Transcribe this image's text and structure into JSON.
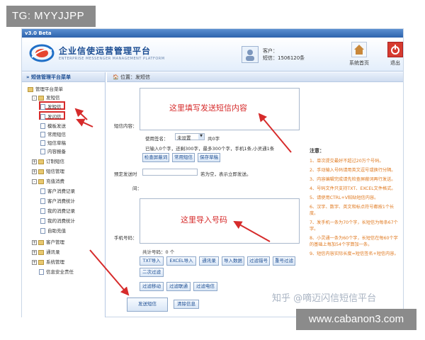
{
  "watermarks": {
    "tg": "TG: MYYJJPP",
    "site": "www.cabanon3.com",
    "zhihu": "知乎 @嘀迈闪信短信平台"
  },
  "window": {
    "version": "v3.0 Beta"
  },
  "header": {
    "brand": "企业信使运营管理平台",
    "brand_sub": "ENTERPRISE MESSENGER MANAGEMENT PLATFORM",
    "customer_label": "客户：",
    "sms_label": "短信：1506120条",
    "home_label": "系统首页",
    "exit_label": "退出"
  },
  "sidebar": {
    "title": "» 短信管理平台菜单",
    "root": "管理平台菜单",
    "send_group": "发短信",
    "items": [
      "发短信",
      "发闪信",
      "模板发送",
      "常用短信",
      "短信草稿",
      "内容报备"
    ],
    "groups": [
      "订制短信",
      "短信管理",
      "充值消费"
    ],
    "recharge_items": [
      "客户消费记录",
      "客户消费统计",
      "我的消费记录",
      "我的消费统计",
      "自助充值"
    ],
    "bottom_groups": [
      "客户管理",
      "通讯录",
      "系统管理",
      "信息安全责任"
    ]
  },
  "main": {
    "breadcrumb": "位置：发短信",
    "content_label": "短信内容：",
    "content_hint": "这里填写发送短信内容",
    "sign_label": "使用签名：",
    "sign_value": "未设置",
    "char_count": "共0字",
    "counter_text": "已输入0个字，还剩300字，最多300个字，手机1条,小灵通1条",
    "btn_check": "检查屏蔽词",
    "btn_common": "常用短信",
    "btn_draft": "保存草稿",
    "schedule_label": "预定发送时",
    "schedule_label2": "间：",
    "schedule_hint": "若为空，表示立即发送。",
    "phone_label": "手机号码：",
    "phone_hint": "这里导入号码",
    "total_label": "共计号码：0 个",
    "import_buttons": [
      "TXT导入",
      "EXCEL导入",
      "通讯录",
      "导入数据",
      "过滤错号",
      "重号过滤"
    ],
    "btn_filter2": "二次过滤",
    "filter_buttons": [
      "过滤移动",
      "过滤联通",
      "过滤电信"
    ],
    "btn_send": "发送短信",
    "btn_clear": "清除信息"
  },
  "notes": {
    "title": "注意：",
    "items": [
      "1、单次提交最好不超过20万个号码。",
      "2、手动输入号码请用英文逗号或换行分隔。",
      "3、内容编辑完成请先检查屏蔽词再行发送。",
      "4、号码文件只支持TXT、EXCEL文件格式。",
      "5、请使用CTRL+V粘贴短信内容。",
      "6、汉字、数字、英文和标点符号都按1个长度。",
      "7、发手机一条为70个字，长短信为每条67个字。",
      "8、小灵通一条为60个字，长短信在每60个字的基础上每加54个字算加一条。",
      "9、短信内容实际长度=短信签名+短信内容。"
    ]
  },
  "colors": {
    "accent": "#1a4c92",
    "annotation": "#d62b2b",
    "notes": "#e07a21"
  }
}
